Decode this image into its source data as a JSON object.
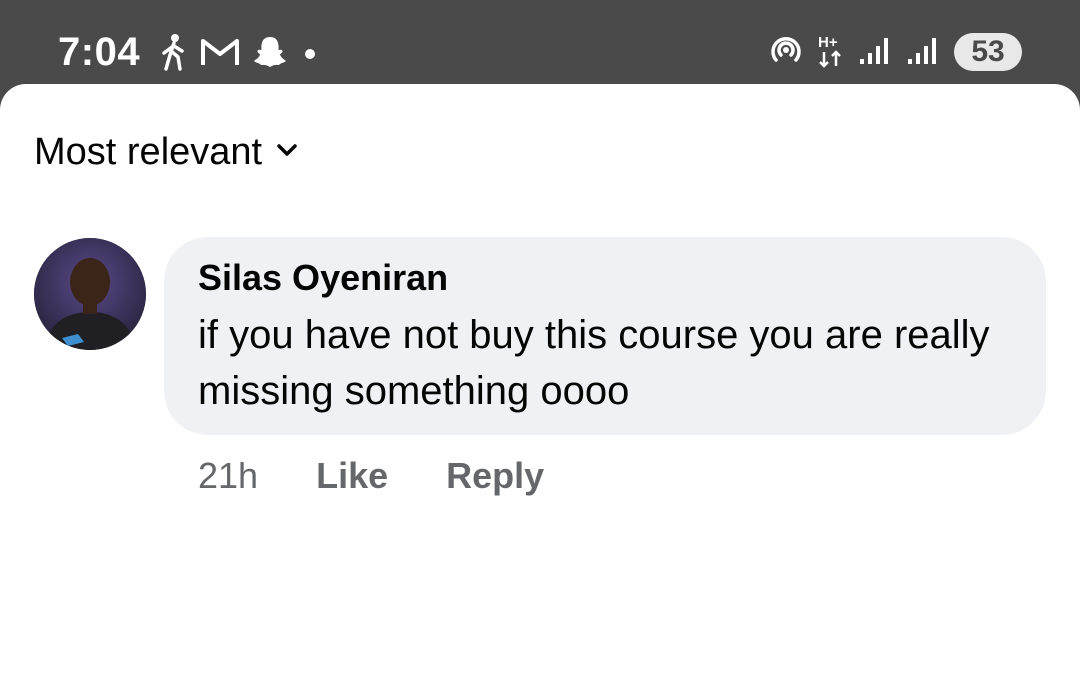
{
  "status_bar": {
    "time": "7:04",
    "battery": "53",
    "left_icons": [
      "walking-person-icon",
      "gmail-icon",
      "snapchat-icon",
      "notification-dot-icon"
    ],
    "right_icons": [
      "hotspot-icon",
      "data-arrows-icon",
      "signal-icon",
      "signal-icon"
    ]
  },
  "sort": {
    "label": "Most relevant"
  },
  "comment": {
    "author": "Silas Oyeniran",
    "text": "if you have not buy this course you are really missing something oooo",
    "time": "21h",
    "like_label": "Like",
    "reply_label": "Reply"
  },
  "colors": {
    "status_bar_bg": "#4a4a4a",
    "bubble_bg": "#f0f1f5",
    "secondary_text": "#65676b",
    "primary_text": "#050505"
  }
}
